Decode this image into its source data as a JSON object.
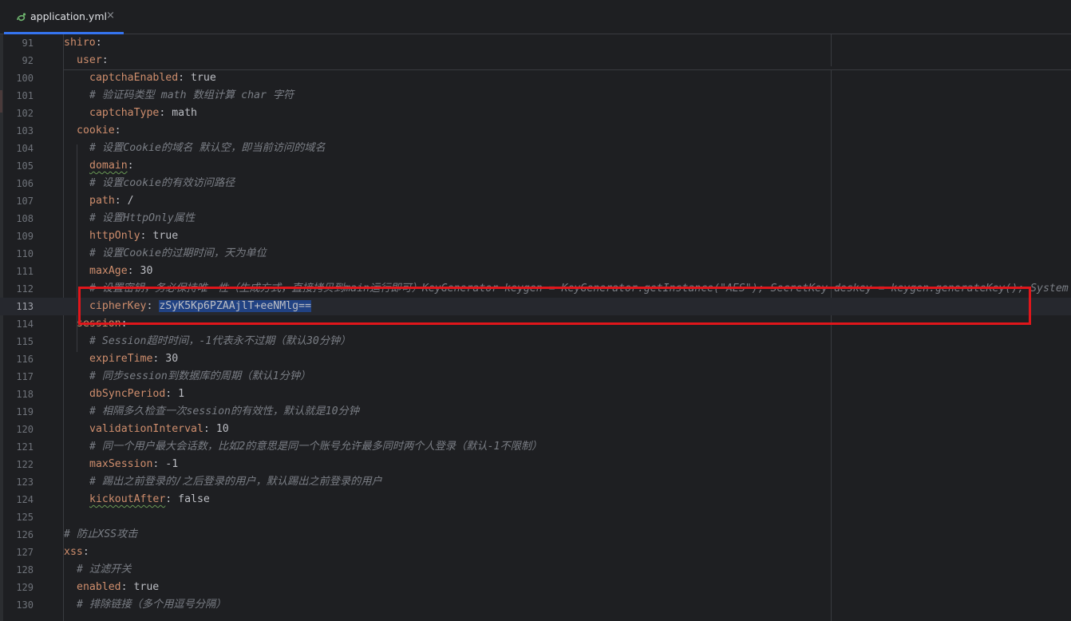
{
  "tab": {
    "filename": "application.yml",
    "close": "×",
    "icon": "yaml-file-icon",
    "accent": "#3574f0"
  },
  "colors": {
    "background": "#1e1f22",
    "key": "#cf8e6d",
    "comment": "#7a7e85",
    "selection": "#214283",
    "highlight_box": "#e0161b"
  },
  "lines": [
    {
      "n": "91",
      "indent": 0,
      "key": "shiro",
      "sep": ":",
      "value": "",
      "comment": ""
    },
    {
      "n": "92",
      "indent": 2,
      "key": "user",
      "sep": ":",
      "value": "",
      "comment": ""
    },
    {
      "n": "100",
      "indent": 4,
      "key": "captchaEnabled",
      "sep": ": ",
      "value": "true",
      "comment": ""
    },
    {
      "n": "101",
      "indent": 4,
      "key": "",
      "sep": "",
      "value": "",
      "comment": "# 验证码类型 math 数组计算 char 字符"
    },
    {
      "n": "102",
      "indent": 4,
      "key": "captchaType",
      "sep": ": ",
      "value": "math",
      "comment": ""
    },
    {
      "n": "103",
      "indent": 2,
      "key": "cookie",
      "sep": ":",
      "value": "",
      "comment": ""
    },
    {
      "n": "104",
      "indent": 4,
      "key": "",
      "sep": "",
      "value": "",
      "comment": "# 设置Cookie的域名 默认空，即当前访问的域名"
    },
    {
      "n": "105",
      "indent": 4,
      "key": "domain",
      "sep": ":",
      "value": "",
      "comment": "",
      "squiggle": true
    },
    {
      "n": "106",
      "indent": 4,
      "key": "",
      "sep": "",
      "value": "",
      "comment": "# 设置cookie的有效访问路径"
    },
    {
      "n": "107",
      "indent": 4,
      "key": "path",
      "sep": ": ",
      "value": "/",
      "comment": ""
    },
    {
      "n": "108",
      "indent": 4,
      "key": "",
      "sep": "",
      "value": "",
      "comment": "# 设置HttpOnly属性"
    },
    {
      "n": "109",
      "indent": 4,
      "key": "httpOnly",
      "sep": ": ",
      "value": "true",
      "comment": ""
    },
    {
      "n": "110",
      "indent": 4,
      "key": "",
      "sep": "",
      "value": "",
      "comment": "# 设置Cookie的过期时间，天为单位"
    },
    {
      "n": "111",
      "indent": 4,
      "key": "maxAge",
      "sep": ": ",
      "value": "30",
      "comment": ""
    },
    {
      "n": "112",
      "indent": 4,
      "key": "",
      "sep": "",
      "value": "",
      "comment": "# 设置密钥，务必保持唯一性（生成方式，直接拷贝到main运行即可）KeyGenerator keygen = KeyGenerator.getInstance(\"AES\"); SecretKey deskey = keygen.generateKey(); System"
    },
    {
      "n": "113",
      "indent": 4,
      "key": "cipherKey",
      "sep": ": ",
      "value": "zSyK5Kp6PZAAjlT+eeNMlg==",
      "comment": "",
      "selected": true,
      "current": true
    },
    {
      "n": "114",
      "indent": 2,
      "key": "session",
      "sep": ":",
      "value": "",
      "comment": ""
    },
    {
      "n": "115",
      "indent": 4,
      "key": "",
      "sep": "",
      "value": "",
      "comment": "# Session超时时间，-1代表永不过期（默认30分钟）"
    },
    {
      "n": "116",
      "indent": 4,
      "key": "expireTime",
      "sep": ": ",
      "value": "30",
      "comment": ""
    },
    {
      "n": "117",
      "indent": 4,
      "key": "",
      "sep": "",
      "value": "",
      "comment": "# 同步session到数据库的周期（默认1分钟）"
    },
    {
      "n": "118",
      "indent": 4,
      "key": "dbSyncPeriod",
      "sep": ": ",
      "value": "1",
      "comment": ""
    },
    {
      "n": "119",
      "indent": 4,
      "key": "",
      "sep": "",
      "value": "",
      "comment": "# 相隔多久检查一次session的有效性，默认就是10分钟"
    },
    {
      "n": "120",
      "indent": 4,
      "key": "validationInterval",
      "sep": ": ",
      "value": "10",
      "comment": ""
    },
    {
      "n": "121",
      "indent": 4,
      "key": "",
      "sep": "",
      "value": "",
      "comment": "# 同一个用户最大会话数，比如2的意思是同一个账号允许最多同时两个人登录（默认-1不限制）"
    },
    {
      "n": "122",
      "indent": 4,
      "key": "maxSession",
      "sep": ": ",
      "value": "-1",
      "comment": ""
    },
    {
      "n": "123",
      "indent": 4,
      "key": "",
      "sep": "",
      "value": "",
      "comment": "# 踢出之前登录的/之后登录的用户，默认踢出之前登录的用户"
    },
    {
      "n": "124",
      "indent": 4,
      "key": "kickoutAfter",
      "sep": ": ",
      "value": "false",
      "comment": "",
      "squiggle": true
    },
    {
      "n": "125",
      "indent": 0,
      "key": "",
      "sep": "",
      "value": "",
      "comment": ""
    },
    {
      "n": "126",
      "indent": 0,
      "key": "",
      "sep": "",
      "value": "",
      "comment": "# 防止XSS攻击"
    },
    {
      "n": "127",
      "indent": 0,
      "key": "xss",
      "sep": ":",
      "value": "",
      "comment": ""
    },
    {
      "n": "128",
      "indent": 2,
      "key": "",
      "sep": "",
      "value": "",
      "comment": "# 过滤开关"
    },
    {
      "n": "129",
      "indent": 2,
      "key": "enabled",
      "sep": ": ",
      "value": "true",
      "comment": ""
    },
    {
      "n": "130",
      "indent": 2,
      "key": "",
      "sep": "",
      "value": "",
      "comment": "# 排除链接（多个用逗号分隔）"
    }
  ]
}
